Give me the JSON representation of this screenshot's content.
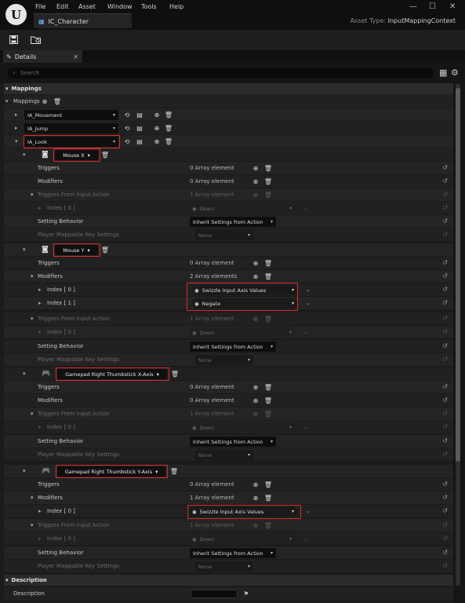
{
  "window": {
    "logo_letter": "U",
    "minimize": "—",
    "maximize": "☐",
    "close": "✕"
  },
  "menu": [
    "File",
    "Edit",
    "Asset",
    "Window",
    "Tools",
    "Help"
  ],
  "doc_tab": {
    "title": "IC_Character"
  },
  "asset_type": {
    "label": "Asset Type:",
    "value": "InputMappingContext"
  },
  "details_tab": {
    "label": "Details"
  },
  "search": {
    "placeholder": "Search"
  },
  "sections": {
    "mappings": "Mappings",
    "description": "Description"
  },
  "mappings_label": "Mappings",
  "actions": [
    "IA_Movement",
    "IA_Jump",
    "IA_Look"
  ],
  "labels": {
    "triggers": "Triggers",
    "modifiers": "Modifiers",
    "triggers_from_action": "Triggers From Input Action",
    "setting_behavior": "Setting Behavior",
    "player_mappable": "Player Mappable Key Settings",
    "index0": "Index [ 0 ]",
    "index1": "Index [ 1 ]",
    "description": "Description"
  },
  "values": {
    "zero_elements": "0 Array element",
    "one_element": "1 Array element",
    "two_elements": "2 Array elements",
    "down": "Down",
    "inherit": "Inherit Settings from Action",
    "none": "None",
    "swizzle": "Swizzle Input Axis Values",
    "negate": "Negate"
  },
  "keys": [
    "Mouse X",
    "Mouse Y",
    "Gamepad Right Thumbstick X-Axis",
    "Gamepad Right Thumbstick Y-Axis"
  ],
  "colors": {
    "highlight": "#d92b2b",
    "background": "#1b1b1b"
  }
}
